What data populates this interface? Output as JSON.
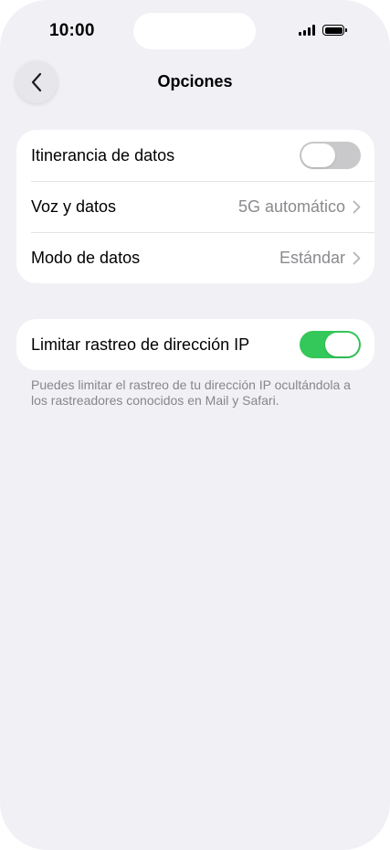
{
  "status_bar": {
    "time": "10:00",
    "signal_icon": "cellular-signal-icon",
    "battery_icon": "battery-icon",
    "battery_level": 1.0
  },
  "nav": {
    "back_icon": "chevron-left-icon",
    "title": "Opciones"
  },
  "group1": {
    "rows": [
      {
        "label": "Itinerancia de datos",
        "control": "toggle",
        "toggle_on": false
      },
      {
        "label": "Voz y datos",
        "value": "5G automático",
        "control": "chevron"
      },
      {
        "label": "Modo de datos",
        "value": "Estándar",
        "control": "chevron"
      }
    ]
  },
  "group2": {
    "rows": [
      {
        "label": "Limitar rastreo de dirección IP",
        "control": "toggle",
        "toggle_on": true
      }
    ],
    "footer": "Puedes limitar el rastreo de tu dirección IP ocultándola a los rastreadores conocidos en Mail y Safari."
  },
  "colors": {
    "background": "#f1f0f5",
    "toggle_on": "#34c759",
    "toggle_off": "#c9c9cb",
    "secondary_text": "#8a8a8e"
  }
}
